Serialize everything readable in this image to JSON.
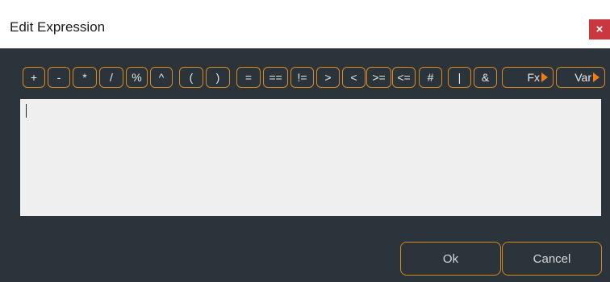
{
  "dialog": {
    "title": "Edit Expression",
    "close_label": "×"
  },
  "toolbar": {
    "plus": "+",
    "minus": "-",
    "multiply": "*",
    "divide": "/",
    "percent": "%",
    "power": "^",
    "open_paren": "(",
    "close_paren": ")",
    "assign": "=",
    "equals": "==",
    "not_equals": "!=",
    "greater": ">",
    "less": "<",
    "greater_equal": ">=",
    "less_equal": "<=",
    "hash": "#",
    "or": "|",
    "and": "&",
    "fx": "Fx",
    "var": "Var"
  },
  "editor": {
    "value": ""
  },
  "actions": {
    "ok": "Ok",
    "cancel": "Cancel"
  },
  "colors": {
    "accent": "#d9881e",
    "background": "#2b333b",
    "editor": "#efefef",
    "close": "#c9383f"
  }
}
